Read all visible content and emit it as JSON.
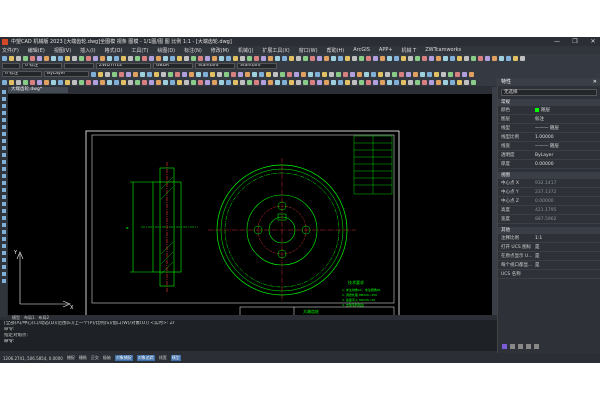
{
  "window": {
    "title": "中望CAD 机械版 2023 [大端齿轮.dwg]全图模 视条 图模 - 1/1图/图 图 比例 1:1 - [大端齿轮.dwg]",
    "controls": [
      "—",
      "❐",
      "✕"
    ]
  },
  "menu": [
    "文件(F)",
    "编辑(E)",
    "视图(V)",
    "插入(I)",
    "格式(O)",
    "工具(T)",
    "绘图(D)",
    "标注(N)",
    "修改(M)",
    "机械(J)",
    "扩展工具(X)",
    "窗口(W)",
    "帮助(H)",
    "ArcGIS",
    "APP+",
    "机械 T",
    "ZWTcamworks"
  ],
  "toolbars": {
    "layer_combo": "0 标注",
    "text_style": "ZWDTITLE",
    "dim_style": "GBDR",
    "linetype": "Standard",
    "plot_style": "Standard",
    "bylayer": "ByLayer"
  },
  "doc_tab": "大端齿轮.dwg*",
  "model_tabs": [
    "模型",
    "布局1",
    "布局2"
  ],
  "drawing": {
    "title_block_label": "大端齿轮",
    "notes_title": "技术要求",
    "note_lines": [
      "1. 未注倒角C1，未注圆角R1",
      "2. 调质处理 HB220~250",
      "3. 齿面淬火 HRC45~50",
      "4. 去除毛刺锐边"
    ]
  },
  "command": {
    "history": "[全部(A)/中心(C)/动态(D)/范围(E)/上一个(P)/比例(S)/窗口(W)/对象(O)] <实时>: Zr",
    "line2": "命令:",
    "line3": "指定对角点:",
    "prompt": "命令:"
  },
  "status": {
    "coords": "1206.2741, 506.5854, 0.0000",
    "buttons": [
      "捕捉",
      "栅格",
      "正交",
      "极轴",
      "对象捕捉",
      "对象追踪",
      "线宽",
      "模型"
    ]
  },
  "properties": {
    "title": "特性",
    "selection": "无选择",
    "general_header": "常规",
    "general": [
      {
        "k": "颜色",
        "v": "随层"
      },
      {
        "k": "图层",
        "v": "标注"
      },
      {
        "k": "线型",
        "v": "——— 随层"
      },
      {
        "k": "线型比例",
        "v": "1.00000"
      },
      {
        "k": "线宽",
        "v": "——— 随层"
      },
      {
        "k": "透明度",
        "v": "ByLayer"
      },
      {
        "k": "厚度",
        "v": "0.00000"
      }
    ],
    "view_header": "视图",
    "view": [
      {
        "k": "中心点 X",
        "v": "932.1417"
      },
      {
        "k": "中心点 Y",
        "v": "237.1372"
      },
      {
        "k": "中心点 Z",
        "v": "0.00000"
      },
      {
        "k": "高度",
        "v": "421.1795"
      },
      {
        "k": "宽度",
        "v": "887.5962"
      }
    ],
    "misc_header": "其他",
    "misc": [
      {
        "k": "注释比例",
        "v": "1:1"
      },
      {
        "k": "打开 UCS 图标",
        "v": "是"
      },
      {
        "k": "在原点显示 U...",
        "v": "是"
      },
      {
        "k": "每个视口都显...",
        "v": "是"
      },
      {
        "k": "UCS 名称",
        "v": ""
      }
    ]
  },
  "colors": {
    "drawing_bg": "#000000",
    "geometry": "#00ff00",
    "frame": "#ffffff",
    "accent": "#3c6ea8"
  }
}
